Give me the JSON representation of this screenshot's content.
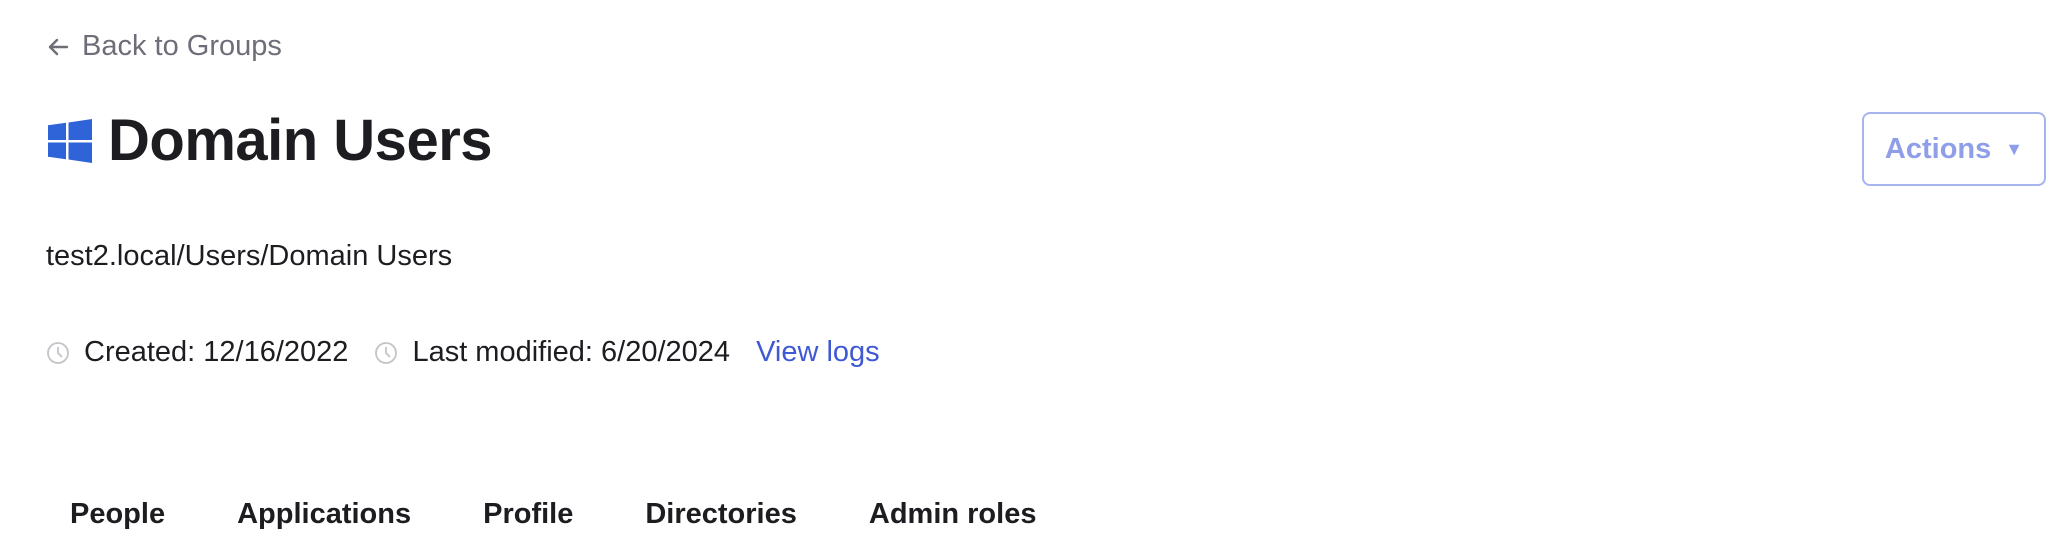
{
  "nav": {
    "back_label": "Back to Groups"
  },
  "group": {
    "title": "Domain Users",
    "icon": "windows-logo-icon",
    "path": "test2.local/Users/Domain Users",
    "created_label": "Created: 12/16/2022",
    "modified_label": "Last modified: 6/20/2024",
    "view_logs_label": "View logs"
  },
  "actions": {
    "label": "Actions",
    "caret": "▼"
  },
  "tabs": [
    {
      "label": "People"
    },
    {
      "label": "Applications"
    },
    {
      "label": "Profile"
    },
    {
      "label": "Directories"
    },
    {
      "label": "Admin roles"
    }
  ],
  "colors": {
    "brand_blue": "#2f63d8",
    "link": "#3f59d4",
    "actions_border": "#a7b5ef",
    "muted_text": "#6e6e78"
  }
}
